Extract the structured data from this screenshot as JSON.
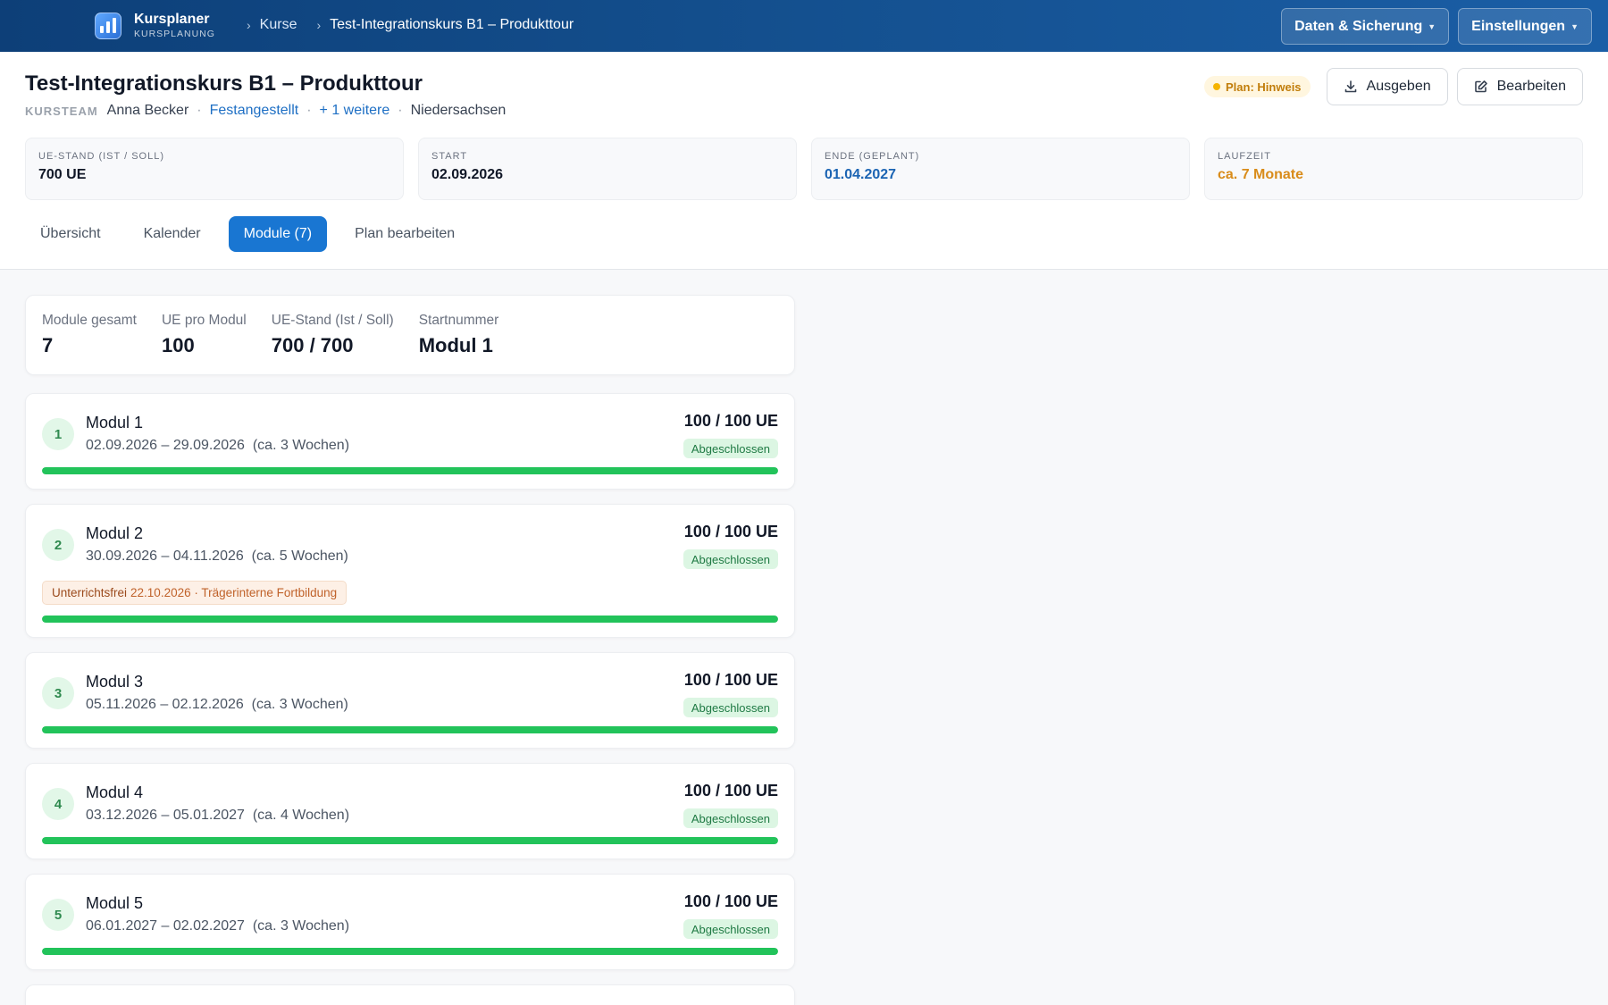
{
  "app": {
    "name": "Kursplaner",
    "subtitle": "KURSPLANUNG"
  },
  "breadcrumb": [
    "Kurse",
    "Test-Integrationskurs B1 – Produkttour"
  ],
  "topbar": {
    "data_label": "Daten & Sicherung",
    "settings_label": "Einstellungen"
  },
  "course": {
    "title": "Test-Integrationskurs B1 – Produkttour",
    "team_label": "KURSTEAM",
    "teacher": "Anna Becker",
    "employment": "Festangestellt",
    "more": "+ 1 weitere",
    "state": "Niedersachsen"
  },
  "header_actions": {
    "plan_badge": "Plan: Hinweis",
    "export_label": "Ausgeben",
    "edit_label": "Bearbeiten"
  },
  "stats": [
    {
      "label": "UE-STAND (IST / SOLL)",
      "value": "700 UE",
      "tone": "default"
    },
    {
      "label": "START",
      "value": "02.09.2026",
      "tone": "default"
    },
    {
      "label": "ENDE (GEPLANT)",
      "value": "01.04.2027",
      "tone": "blue"
    },
    {
      "label": "LAUFZEIT",
      "value": "ca. 7 Monate",
      "tone": "orange"
    }
  ],
  "tabs": [
    {
      "label": "Übersicht",
      "active": false
    },
    {
      "label": "Kalender",
      "active": false
    },
    {
      "label": "Module (7)",
      "active": true
    },
    {
      "label": "Plan bearbeiten",
      "active": false
    }
  ],
  "summary": [
    {
      "label": "Module gesamt",
      "value": "7"
    },
    {
      "label": "UE pro Modul",
      "value": "100"
    },
    {
      "label": "UE-Stand (Ist / Soll)",
      "value": "700 / 700"
    },
    {
      "label": "Startnummer",
      "value": "Modul 1"
    }
  ],
  "modules": [
    {
      "num": "1",
      "title": "Modul 1",
      "dates": "02.09.2026 – 29.09.2026  (ca. 3 Wochen)",
      "ue": "100 / 100 UE",
      "status": "Abgeschlossen",
      "progress": 1.0
    },
    {
      "num": "2",
      "title": "Modul 2",
      "dates": "30.09.2026 – 04.11.2026  (ca. 5 Wochen)",
      "ue": "100 / 100 UE",
      "status": "Abgeschlossen",
      "progress": 1.0,
      "holiday": {
        "label": "Unterrichtsfrei",
        "text": "22.10.2026 · Trägerinterne Fortbildung"
      }
    },
    {
      "num": "3",
      "title": "Modul 3",
      "dates": "05.11.2026 – 02.12.2026  (ca. 3 Wochen)",
      "ue": "100 / 100 UE",
      "status": "Abgeschlossen",
      "progress": 1.0
    },
    {
      "num": "4",
      "title": "Modul 4",
      "dates": "03.12.2026 – 05.01.2027  (ca. 4 Wochen)",
      "ue": "100 / 100 UE",
      "status": "Abgeschlossen",
      "progress": 1.0
    },
    {
      "num": "5",
      "title": "Modul 5",
      "dates": "06.01.2027 – 02.02.2027  (ca. 3 Wochen)",
      "ue": "100 / 100 UE",
      "status": "Abgeschlossen",
      "progress": 1.0
    }
  ]
}
